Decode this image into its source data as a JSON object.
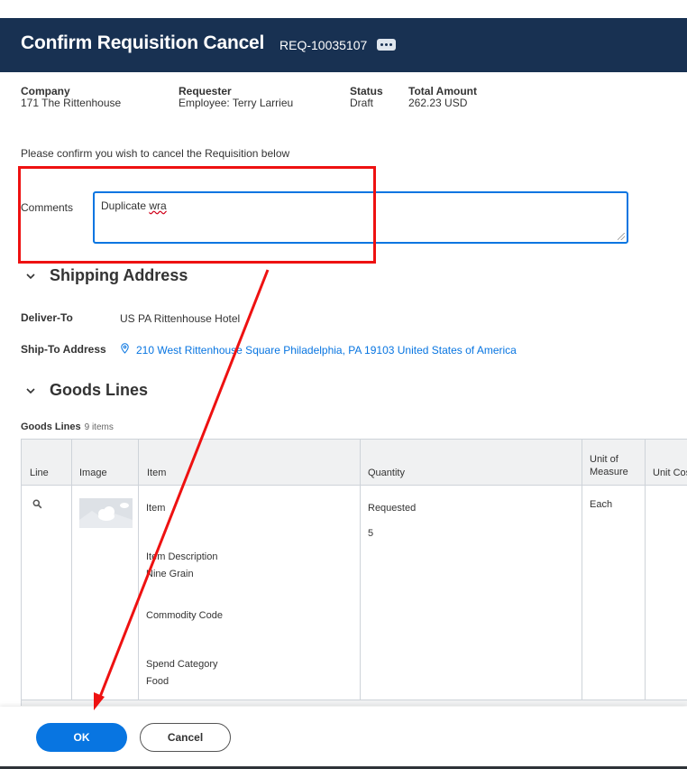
{
  "header": {
    "title": "Confirm Requisition Cancel",
    "req_id": "REQ-10035107",
    "more_icon": "ellipsis-icon"
  },
  "summary": {
    "company_label": "Company",
    "company_value": "171 The Rittenhouse",
    "requester_label": "Requester",
    "requester_value": "Employee: Terry Larrieu",
    "status_label": "Status",
    "status_value": "Draft",
    "total_label": "Total Amount",
    "total_value": "262.23 USD"
  },
  "confirm_text": "Please confirm you wish to cancel the Requisition below",
  "comments": {
    "label": "Comments",
    "value_prefix": "Duplicate ",
    "value_misspelled": "wra"
  },
  "shipping": {
    "heading": "Shipping Address",
    "deliver_to_label": "Deliver-To",
    "deliver_to_value": "US PA Rittenhouse Hotel",
    "ship_to_label": "Ship-To Address",
    "ship_to_value": "210 West Rittenhouse Square Philadelphia, PA 19103 United States of America"
  },
  "goods": {
    "heading": "Goods Lines",
    "caption": "Goods Lines",
    "count": "9 items",
    "columns": [
      "Line",
      "Image",
      "Item",
      "Quantity",
      "Unit of Measure",
      "Unit Cost"
    ],
    "row": {
      "item_label": "Item",
      "item_description_label": "Item Description",
      "item_description_value": "Nine Grain",
      "commodity_code_label": "Commodity Code",
      "spend_category_label": "Spend Category",
      "spend_category_value": "Food",
      "quantity_label": "Requested",
      "quantity_value": "5",
      "unit_of_measure": "Each"
    }
  },
  "footer": {
    "ok_label": "OK",
    "cancel_label": "Cancel"
  },
  "colors": {
    "header_bg": "#183152",
    "primary": "#0875e1",
    "annotation": "#ee1111"
  }
}
